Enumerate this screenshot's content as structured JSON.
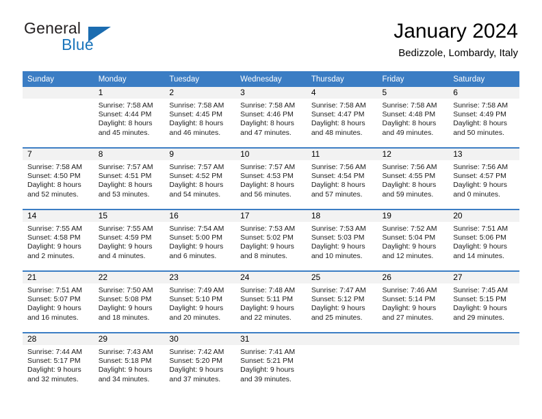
{
  "brand": {
    "word_one": "General",
    "word_two": "Blue",
    "triangle_icon": "triangle-logo-icon",
    "accent_color": "#1b75bb"
  },
  "header": {
    "month_title": "January 2024",
    "location": "Bedizzole, Lombardy, Italy"
  },
  "calendar": {
    "header_bg": "#3b7dc4",
    "daynum_bg": "#f2f2f2",
    "weekday_headers": [
      "Sunday",
      "Monday",
      "Tuesday",
      "Wednesday",
      "Thursday",
      "Friday",
      "Saturday"
    ],
    "weeks": [
      [
        {
          "day": ""
        },
        {
          "day": "1",
          "sunrise": "Sunrise: 7:58 AM",
          "sunset": "Sunset: 4:44 PM",
          "daylight_line1": "Daylight: 8 hours",
          "daylight_line2": "and 45 minutes."
        },
        {
          "day": "2",
          "sunrise": "Sunrise: 7:58 AM",
          "sunset": "Sunset: 4:45 PM",
          "daylight_line1": "Daylight: 8 hours",
          "daylight_line2": "and 46 minutes."
        },
        {
          "day": "3",
          "sunrise": "Sunrise: 7:58 AM",
          "sunset": "Sunset: 4:46 PM",
          "daylight_line1": "Daylight: 8 hours",
          "daylight_line2": "and 47 minutes."
        },
        {
          "day": "4",
          "sunrise": "Sunrise: 7:58 AM",
          "sunset": "Sunset: 4:47 PM",
          "daylight_line1": "Daylight: 8 hours",
          "daylight_line2": "and 48 minutes."
        },
        {
          "day": "5",
          "sunrise": "Sunrise: 7:58 AM",
          "sunset": "Sunset: 4:48 PM",
          "daylight_line1": "Daylight: 8 hours",
          "daylight_line2": "and 49 minutes."
        },
        {
          "day": "6",
          "sunrise": "Sunrise: 7:58 AM",
          "sunset": "Sunset: 4:49 PM",
          "daylight_line1": "Daylight: 8 hours",
          "daylight_line2": "and 50 minutes."
        }
      ],
      [
        {
          "day": "7",
          "sunrise": "Sunrise: 7:58 AM",
          "sunset": "Sunset: 4:50 PM",
          "daylight_line1": "Daylight: 8 hours",
          "daylight_line2": "and 52 minutes."
        },
        {
          "day": "8",
          "sunrise": "Sunrise: 7:57 AM",
          "sunset": "Sunset: 4:51 PM",
          "daylight_line1": "Daylight: 8 hours",
          "daylight_line2": "and 53 minutes."
        },
        {
          "day": "9",
          "sunrise": "Sunrise: 7:57 AM",
          "sunset": "Sunset: 4:52 PM",
          "daylight_line1": "Daylight: 8 hours",
          "daylight_line2": "and 54 minutes."
        },
        {
          "day": "10",
          "sunrise": "Sunrise: 7:57 AM",
          "sunset": "Sunset: 4:53 PM",
          "daylight_line1": "Daylight: 8 hours",
          "daylight_line2": "and 56 minutes."
        },
        {
          "day": "11",
          "sunrise": "Sunrise: 7:56 AM",
          "sunset": "Sunset: 4:54 PM",
          "daylight_line1": "Daylight: 8 hours",
          "daylight_line2": "and 57 minutes."
        },
        {
          "day": "12",
          "sunrise": "Sunrise: 7:56 AM",
          "sunset": "Sunset: 4:55 PM",
          "daylight_line1": "Daylight: 8 hours",
          "daylight_line2": "and 59 minutes."
        },
        {
          "day": "13",
          "sunrise": "Sunrise: 7:56 AM",
          "sunset": "Sunset: 4:57 PM",
          "daylight_line1": "Daylight: 9 hours",
          "daylight_line2": "and 0 minutes."
        }
      ],
      [
        {
          "day": "14",
          "sunrise": "Sunrise: 7:55 AM",
          "sunset": "Sunset: 4:58 PM",
          "daylight_line1": "Daylight: 9 hours",
          "daylight_line2": "and 2 minutes."
        },
        {
          "day": "15",
          "sunrise": "Sunrise: 7:55 AM",
          "sunset": "Sunset: 4:59 PM",
          "daylight_line1": "Daylight: 9 hours",
          "daylight_line2": "and 4 minutes."
        },
        {
          "day": "16",
          "sunrise": "Sunrise: 7:54 AM",
          "sunset": "Sunset: 5:00 PM",
          "daylight_line1": "Daylight: 9 hours",
          "daylight_line2": "and 6 minutes."
        },
        {
          "day": "17",
          "sunrise": "Sunrise: 7:53 AM",
          "sunset": "Sunset: 5:02 PM",
          "daylight_line1": "Daylight: 9 hours",
          "daylight_line2": "and 8 minutes."
        },
        {
          "day": "18",
          "sunrise": "Sunrise: 7:53 AM",
          "sunset": "Sunset: 5:03 PM",
          "daylight_line1": "Daylight: 9 hours",
          "daylight_line2": "and 10 minutes."
        },
        {
          "day": "19",
          "sunrise": "Sunrise: 7:52 AM",
          "sunset": "Sunset: 5:04 PM",
          "daylight_line1": "Daylight: 9 hours",
          "daylight_line2": "and 12 minutes."
        },
        {
          "day": "20",
          "sunrise": "Sunrise: 7:51 AM",
          "sunset": "Sunset: 5:06 PM",
          "daylight_line1": "Daylight: 9 hours",
          "daylight_line2": "and 14 minutes."
        }
      ],
      [
        {
          "day": "21",
          "sunrise": "Sunrise: 7:51 AM",
          "sunset": "Sunset: 5:07 PM",
          "daylight_line1": "Daylight: 9 hours",
          "daylight_line2": "and 16 minutes."
        },
        {
          "day": "22",
          "sunrise": "Sunrise: 7:50 AM",
          "sunset": "Sunset: 5:08 PM",
          "daylight_line1": "Daylight: 9 hours",
          "daylight_line2": "and 18 minutes."
        },
        {
          "day": "23",
          "sunrise": "Sunrise: 7:49 AM",
          "sunset": "Sunset: 5:10 PM",
          "daylight_line1": "Daylight: 9 hours",
          "daylight_line2": "and 20 minutes."
        },
        {
          "day": "24",
          "sunrise": "Sunrise: 7:48 AM",
          "sunset": "Sunset: 5:11 PM",
          "daylight_line1": "Daylight: 9 hours",
          "daylight_line2": "and 22 minutes."
        },
        {
          "day": "25",
          "sunrise": "Sunrise: 7:47 AM",
          "sunset": "Sunset: 5:12 PM",
          "daylight_line1": "Daylight: 9 hours",
          "daylight_line2": "and 25 minutes."
        },
        {
          "day": "26",
          "sunrise": "Sunrise: 7:46 AM",
          "sunset": "Sunset: 5:14 PM",
          "daylight_line1": "Daylight: 9 hours",
          "daylight_line2": "and 27 minutes."
        },
        {
          "day": "27",
          "sunrise": "Sunrise: 7:45 AM",
          "sunset": "Sunset: 5:15 PM",
          "daylight_line1": "Daylight: 9 hours",
          "daylight_line2": "and 29 minutes."
        }
      ],
      [
        {
          "day": "28",
          "sunrise": "Sunrise: 7:44 AM",
          "sunset": "Sunset: 5:17 PM",
          "daylight_line1": "Daylight: 9 hours",
          "daylight_line2": "and 32 minutes."
        },
        {
          "day": "29",
          "sunrise": "Sunrise: 7:43 AM",
          "sunset": "Sunset: 5:18 PM",
          "daylight_line1": "Daylight: 9 hours",
          "daylight_line2": "and 34 minutes."
        },
        {
          "day": "30",
          "sunrise": "Sunrise: 7:42 AM",
          "sunset": "Sunset: 5:20 PM",
          "daylight_line1": "Daylight: 9 hours",
          "daylight_line2": "and 37 minutes."
        },
        {
          "day": "31",
          "sunrise": "Sunrise: 7:41 AM",
          "sunset": "Sunset: 5:21 PM",
          "daylight_line1": "Daylight: 9 hours",
          "daylight_line2": "and 39 minutes."
        },
        {
          "day": ""
        },
        {
          "day": ""
        },
        {
          "day": ""
        }
      ]
    ]
  }
}
